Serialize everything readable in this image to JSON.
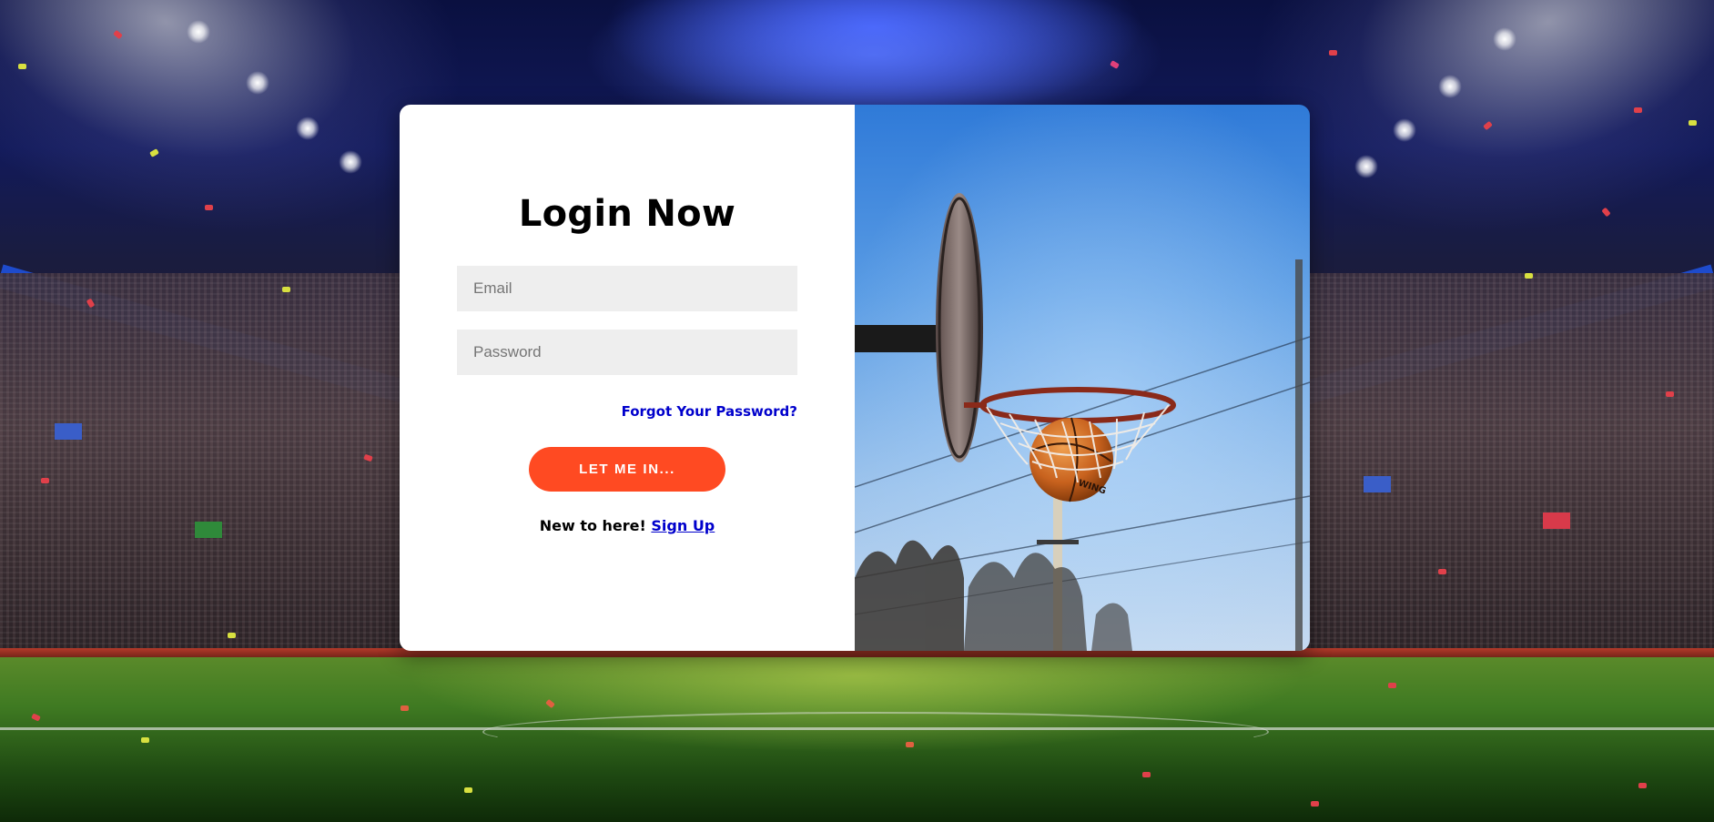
{
  "login": {
    "title": "Login Now",
    "email_placeholder": "Email",
    "password_placeholder": "Password",
    "forgot_password": "Forgot Your Password?",
    "submit_label": "LET ME IN...",
    "signup_prompt": "New to here!",
    "signup_link": "Sign Up"
  },
  "colors": {
    "button": "#ff4a22",
    "link": "#0000cc",
    "input_bg": "#eeeeee",
    "card_bg": "#ffffff"
  },
  "photo": {
    "subject": "basketball-hoop-photo",
    "ball_print": "WING"
  }
}
